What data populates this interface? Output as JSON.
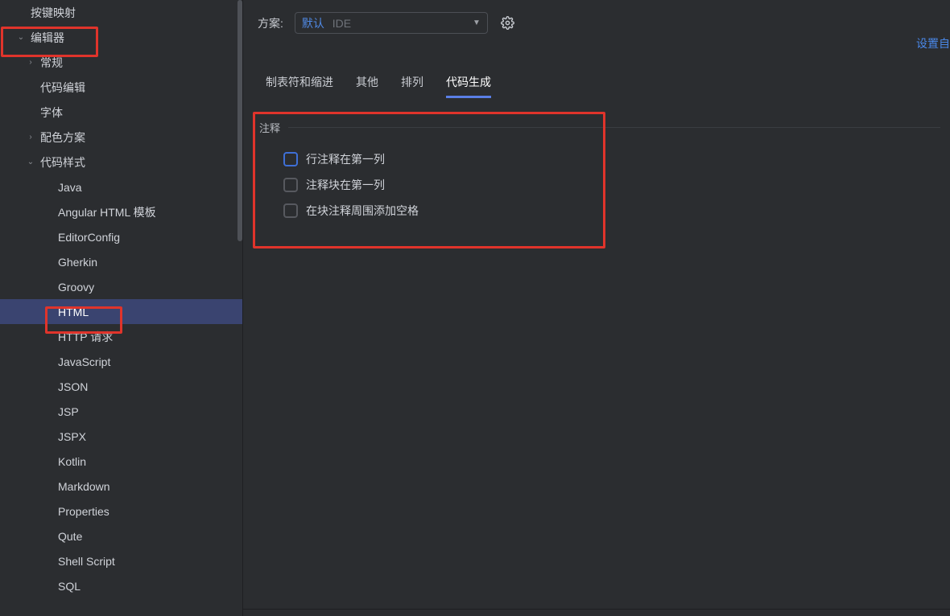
{
  "sidebar": {
    "items": [
      {
        "label": "按键映射",
        "level": 0,
        "expand": null
      },
      {
        "label": "编辑器",
        "level": 0,
        "expand": "down"
      },
      {
        "label": "常规",
        "level": 1,
        "expand": "right"
      },
      {
        "label": "代码编辑",
        "level": 1,
        "expand": null
      },
      {
        "label": "字体",
        "level": 1,
        "expand": null
      },
      {
        "label": "配色方案",
        "level": 1,
        "expand": "right"
      },
      {
        "label": "代码样式",
        "level": 1,
        "expand": "down"
      },
      {
        "label": "Java",
        "level": 3,
        "expand": null
      },
      {
        "label": "Angular HTML 模板",
        "level": 3,
        "expand": null
      },
      {
        "label": "EditorConfig",
        "level": 3,
        "expand": null
      },
      {
        "label": "Gherkin",
        "level": 3,
        "expand": null
      },
      {
        "label": "Groovy",
        "level": 3,
        "expand": null
      },
      {
        "label": "HTML",
        "level": 3,
        "expand": null,
        "selected": true
      },
      {
        "label": "HTTP 请求",
        "level": 3,
        "expand": null
      },
      {
        "label": "JavaScript",
        "level": 3,
        "expand": null
      },
      {
        "label": "JSON",
        "level": 3,
        "expand": null
      },
      {
        "label": "JSP",
        "level": 3,
        "expand": null
      },
      {
        "label": "JSPX",
        "level": 3,
        "expand": null
      },
      {
        "label": "Kotlin",
        "level": 3,
        "expand": null
      },
      {
        "label": "Markdown",
        "level": 3,
        "expand": null
      },
      {
        "label": "Properties",
        "level": 3,
        "expand": null
      },
      {
        "label": "Qute",
        "level": 3,
        "expand": null
      },
      {
        "label": "Shell Script",
        "level": 3,
        "expand": null
      },
      {
        "label": "SQL",
        "level": 3,
        "expand": "right"
      }
    ]
  },
  "top": {
    "scheme_label": "方案:",
    "scheme_value": "默认",
    "scheme_trail": "IDE",
    "link": "设置自"
  },
  "tabs": [
    {
      "label": "制表符和缩进"
    },
    {
      "label": "其他"
    },
    {
      "label": "排列"
    },
    {
      "label": "代码生成",
      "active": true
    }
  ],
  "fieldset": {
    "legend": "注释",
    "options": [
      {
        "label": "行注释在第一列",
        "highlighted": true
      },
      {
        "label": "注释块在第一列",
        "highlighted": false
      },
      {
        "label": "在块注释周围添加空格",
        "highlighted": false
      }
    ]
  }
}
